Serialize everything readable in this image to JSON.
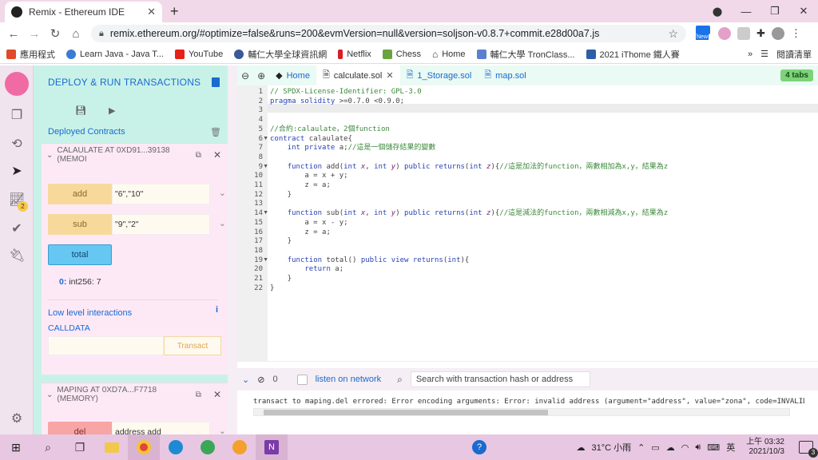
{
  "browser": {
    "tab_title": "Remix - Ethereum IDE",
    "url": "remix.ethereum.org/#optimize=false&runs=200&evmVersion=null&version=soljson-v0.8.7+commit.e28d00a7.js",
    "ext_new_badge": "New",
    "bookmarks": [
      {
        "label": "應用程式",
        "icon": "apps-icon"
      },
      {
        "label": "Learn Java - Java T...",
        "icon": "learnjava-icon"
      },
      {
        "label": "YouTube",
        "icon": "youtube-icon"
      },
      {
        "label": "輔仁大學全球資訊網",
        "icon": "fju-icon"
      },
      {
        "label": "Netflix",
        "icon": "netflix-icon"
      },
      {
        "label": "Chess",
        "icon": "chess-icon"
      },
      {
        "label": "Home",
        "icon": "home-icon"
      },
      {
        "label": "輔仁大學 TronClass...",
        "icon": "tronclass-icon"
      },
      {
        "label": "2021 iThome 鐵人賽",
        "icon": "ithome-icon"
      }
    ],
    "bookmarks_more": "»",
    "reading_list": "閱讀清單"
  },
  "sidebar": {
    "title": "DEPLOY & RUN TRANSACTIONS",
    "deployed_label": "Deployed Contracts",
    "icon_badge": "2",
    "instance1": {
      "title": "CALAULATE AT 0XD91...39138 (MEMOI",
      "functions": [
        {
          "name": "add",
          "value": "\"6\",\"10\""
        },
        {
          "name": "sub",
          "value": "\"9\",\"2\""
        }
      ],
      "total_label": "total",
      "result_key": "0:",
      "result_val": "int256: 7",
      "low_level": "Low level interactions",
      "info": "i",
      "calldata": "CALLDATA",
      "transact": "Transact"
    },
    "instance2": {
      "title": "MAPING AT 0XD7A...F7718 (MEMORY)",
      "fn_name": "del",
      "fn_value": "address add"
    }
  },
  "editor": {
    "tabs": [
      {
        "label": "Home",
        "icon": "remix-home-icon",
        "active": false,
        "closable": false
      },
      {
        "label": "calculate.sol",
        "icon": "file-icon",
        "active": true,
        "closable": true
      },
      {
        "label": "1_Storage.sol",
        "icon": "file-icon",
        "active": false,
        "closable": false
      },
      {
        "label": "map.sol",
        "icon": "file-icon",
        "active": false,
        "closable": false
      }
    ],
    "tabs_count": "4 tabs",
    "lines": [
      "// SPDX-License-Identifier: GPL-3.0",
      "pragma solidity >=0.7.0 <0.9.0;",
      "",
      "",
      "//合約:calaulate，2個function",
      "contract calaulate{",
      "    int private a;//這是一個儲存結果的變數",
      "",
      "    function add(int x, int y) public returns(int z){//這是加法的function，兩數相加為x,y，結果為z",
      "        a = x + y;",
      "        z = a;",
      "    }",
      "",
      "    function sub(int x, int y) public returns(int z){//這是減法的function，兩數相減為x,y，結果為z",
      "        a = x - y;",
      "        z = a;",
      "    }",
      "",
      "    function total() public view returns(int){",
      "        return a;",
      "    }",
      "}"
    ]
  },
  "terminal": {
    "count": "0",
    "listen_label": "listen on network",
    "search_placeholder": "Search with transaction hash or address",
    "message": "transact to maping.del errored: Error encoding arguments: Error: invalid address (argument=\"address\", value=\"zona\", code=INVALID"
  },
  "taskbar": {
    "weather": "31°C 小雨",
    "ime": "英",
    "time": "上午 03:32",
    "date": "2021/10/3",
    "notif_count": "3"
  }
}
